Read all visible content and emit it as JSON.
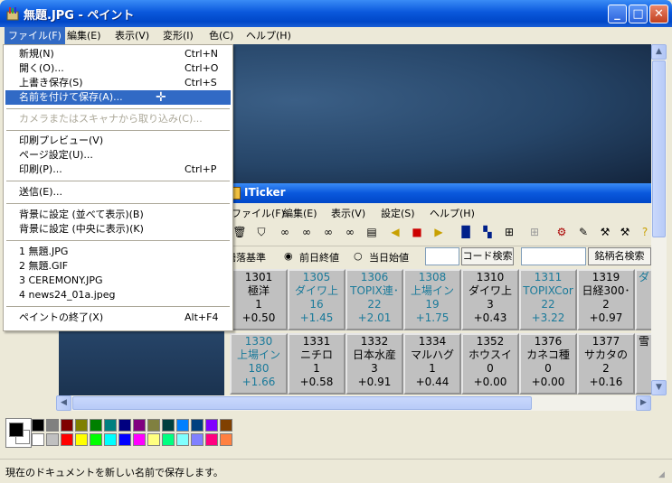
{
  "window": {
    "title": "無題.JPG - ペイント",
    "controls": {
      "minimize": "_",
      "maximize": "□",
      "close": "✕"
    }
  },
  "menubar": [
    {
      "label": "ファイル(F)",
      "active": true
    },
    {
      "label": "編集(E)"
    },
    {
      "label": "表示(V)"
    },
    {
      "label": "変形(I)"
    },
    {
      "label": "色(C)"
    },
    {
      "label": "ヘルプ(H)"
    }
  ],
  "file_menu": {
    "new": {
      "label": "新規(N)",
      "shortcut": "Ctrl+N"
    },
    "open": {
      "label": "開く(O)...",
      "shortcut": "Ctrl+O"
    },
    "save": {
      "label": "上書き保存(S)",
      "shortcut": "Ctrl+S"
    },
    "save_as": {
      "label": "名前を付けて保存(A)..."
    },
    "scanner": {
      "label": "カメラまたはスキャナから取り込み(C)..."
    },
    "print_preview": {
      "label": "印刷プレビュー(V)"
    },
    "page_setup": {
      "label": "ページ設定(U)..."
    },
    "print": {
      "label": "印刷(P)...",
      "shortcut": "Ctrl+P"
    },
    "send": {
      "label": "送信(E)..."
    },
    "wallpaper_tile": {
      "label": "背景に設定 (並べて表示)(B)"
    },
    "wallpaper_center": {
      "label": "背景に設定 (中央に表示)(K)"
    },
    "recent": [
      "1 無題.JPG",
      "2 無題.GIF",
      "3 CEREMONY.JPG",
      "4 news24_01a.jpeg"
    ],
    "exit": {
      "label": "ペイントの終了(X)",
      "shortcut": "Alt+F4"
    }
  },
  "status": "現在のドキュメントを新しい名前で保存します。",
  "palette": {
    "foreground": "#000000",
    "background": "#ffffff",
    "row1": [
      "#000000",
      "#808080",
      "#800000",
      "#808000",
      "#008000",
      "#008080",
      "#000080",
      "#800080",
      "#808040",
      "#004040",
      "#0080ff",
      "#004080",
      "#8000ff",
      "#804000"
    ],
    "row2": [
      "#ffffff",
      "#c0c0c0",
      "#ff0000",
      "#ffff00",
      "#00ff00",
      "#00ffff",
      "#0000ff",
      "#ff00ff",
      "#ffff80",
      "#00ff80",
      "#80ffff",
      "#8080ff",
      "#ff0080",
      "#ff8040"
    ]
  },
  "iticker": {
    "title": "ITicker",
    "menu": [
      "ファイル(F)",
      "編集(E)",
      "表示(V)",
      "設定(S)",
      "ヘルプ(H)"
    ],
    "toolbar_icons": [
      "delete-icon",
      "filter-icon",
      "binoculars-icon",
      "binoculars-icon",
      "binoculars-icon",
      "binoculars-icon",
      "print-icon",
      "arrow-left-icon",
      "stop-icon",
      "arrow-right-icon",
      "grid-1-icon",
      "grid-2-icon",
      "grid-4-icon",
      "grid-disabled-icon",
      "tools-icon",
      "edit-icon",
      "hammer-icon",
      "hammer-icon",
      "help-icon"
    ],
    "options": {
      "basis_label": "騰落基準",
      "prev_close": "前日終値",
      "today_open": "当日始値",
      "code_search": "コード検索",
      "name_search": "銘柄名検索"
    },
    "tiles_row1": [
      {
        "code": "1301",
        "name": "極洋",
        "val": "1",
        "chg": "+0.50",
        "up": false
      },
      {
        "code": "1305",
        "name": "ダイワ上",
        "val": "16",
        "chg": "+1.45",
        "up": true
      },
      {
        "code": "1306",
        "name": "TOPIX連･",
        "val": "22",
        "chg": "+2.01",
        "up": true
      },
      {
        "code": "1308",
        "name": "上場イン",
        "val": "19",
        "chg": "+1.75",
        "up": true
      },
      {
        "code": "1310",
        "name": "ダイワ上",
        "val": "3",
        "chg": "+0.43",
        "up": false
      },
      {
        "code": "1311",
        "name": "TOPIXCor",
        "val": "22",
        "chg": "+3.22",
        "up": true
      },
      {
        "code": "1319",
        "name": "日経300･",
        "val": "2",
        "chg": "+0.97",
        "up": false
      },
      {
        "code": "",
        "name": "ダ",
        "val": "",
        "chg": "",
        "up": true
      }
    ],
    "tiles_row2": [
      {
        "code": "1330",
        "name": "上場イン",
        "val": "180",
        "chg": "+1.66",
        "up": true
      },
      {
        "code": "1331",
        "name": "ニチロ",
        "val": "1",
        "chg": "+0.58",
        "up": false
      },
      {
        "code": "1332",
        "name": "日本水産",
        "val": "3",
        "chg": "+0.91",
        "up": false
      },
      {
        "code": "1334",
        "name": "マルハグ",
        "val": "1",
        "chg": "+0.44",
        "up": false
      },
      {
        "code": "1352",
        "name": "ホウスイ",
        "val": "0",
        "chg": "+0.00",
        "up": false
      },
      {
        "code": "1376",
        "name": "カネコ種",
        "val": "0",
        "chg": "+0.00",
        "up": false
      },
      {
        "code": "1377",
        "name": "サカタの",
        "val": "2",
        "chg": "+0.16",
        "up": false
      },
      {
        "code": "",
        "name": "雪",
        "val": "",
        "chg": "",
        "up": false
      }
    ]
  }
}
